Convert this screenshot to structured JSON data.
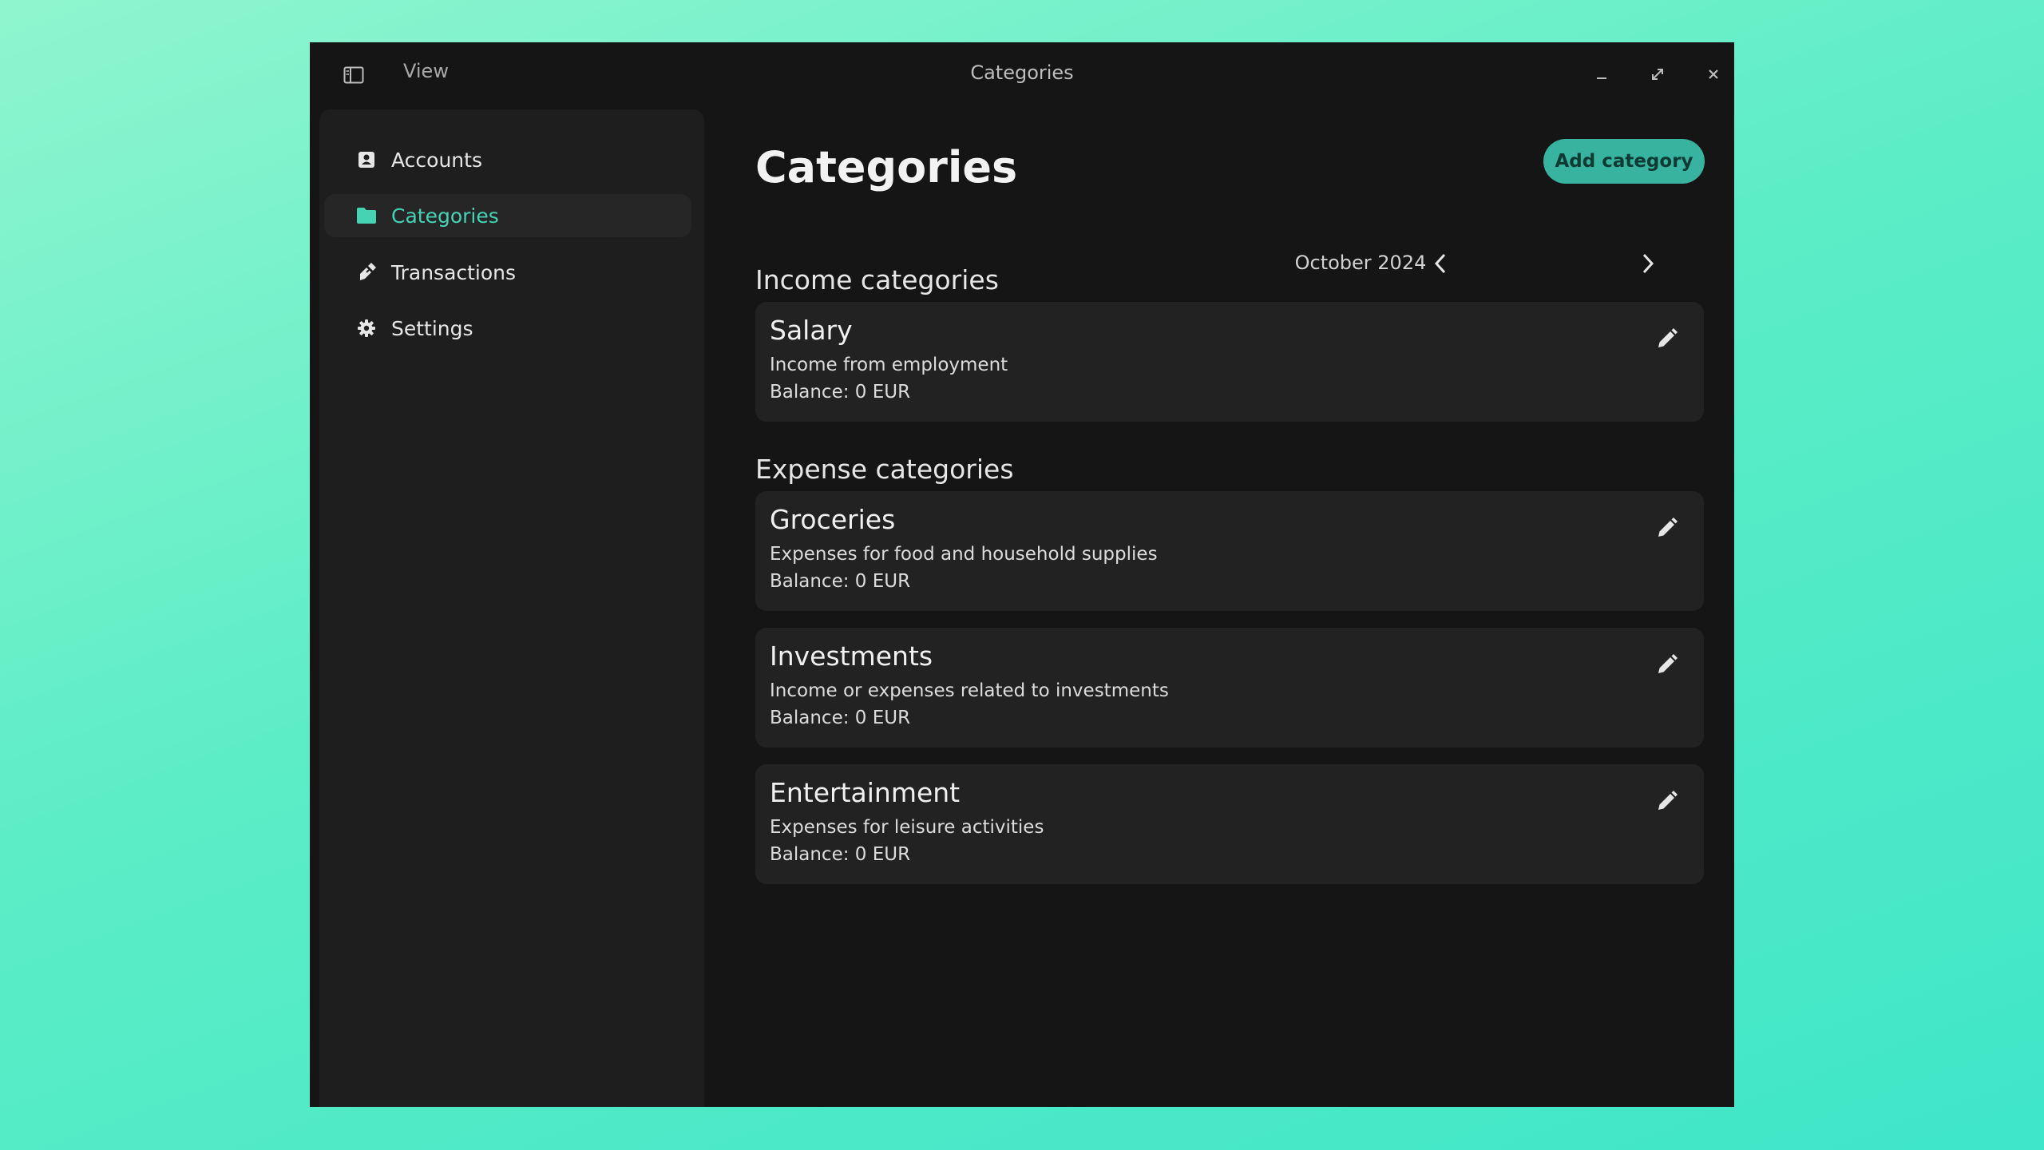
{
  "window": {
    "title": "Categories",
    "menu_view_label": "View"
  },
  "sidebar": {
    "items": [
      {
        "label": "Accounts",
        "icon": "account-card-icon",
        "active": false
      },
      {
        "label": "Categories",
        "icon": "folder-icon",
        "active": true
      },
      {
        "label": "Transactions",
        "icon": "transactions-icon",
        "active": false
      },
      {
        "label": "Settings",
        "icon": "gear-icon",
        "active": false
      }
    ]
  },
  "main": {
    "title": "Categories",
    "add_button_label": "Add category",
    "month_label": "October 2024"
  },
  "income": {
    "heading": "Income categories",
    "items": [
      {
        "name": "Salary",
        "description": "Income from employment",
        "balance": "Balance: 0 EUR"
      }
    ]
  },
  "expense": {
    "heading": "Expense categories",
    "items": [
      {
        "name": "Groceries",
        "description": "Expenses for food and household supplies",
        "balance": "Balance: 0 EUR"
      },
      {
        "name": "Investments",
        "description": "Income or expenses related to investments",
        "balance": "Balance: 0 EUR"
      },
      {
        "name": "Entertainment",
        "description": "Expenses for leisure activities",
        "balance": "Balance: 0 EUR"
      }
    ]
  },
  "colors": {
    "accent": "#45d3b4",
    "button_bg": "#37b3a0",
    "window_bg": "#151515",
    "sidebar_bg": "#1e1e1e",
    "card_bg": "#222222"
  }
}
